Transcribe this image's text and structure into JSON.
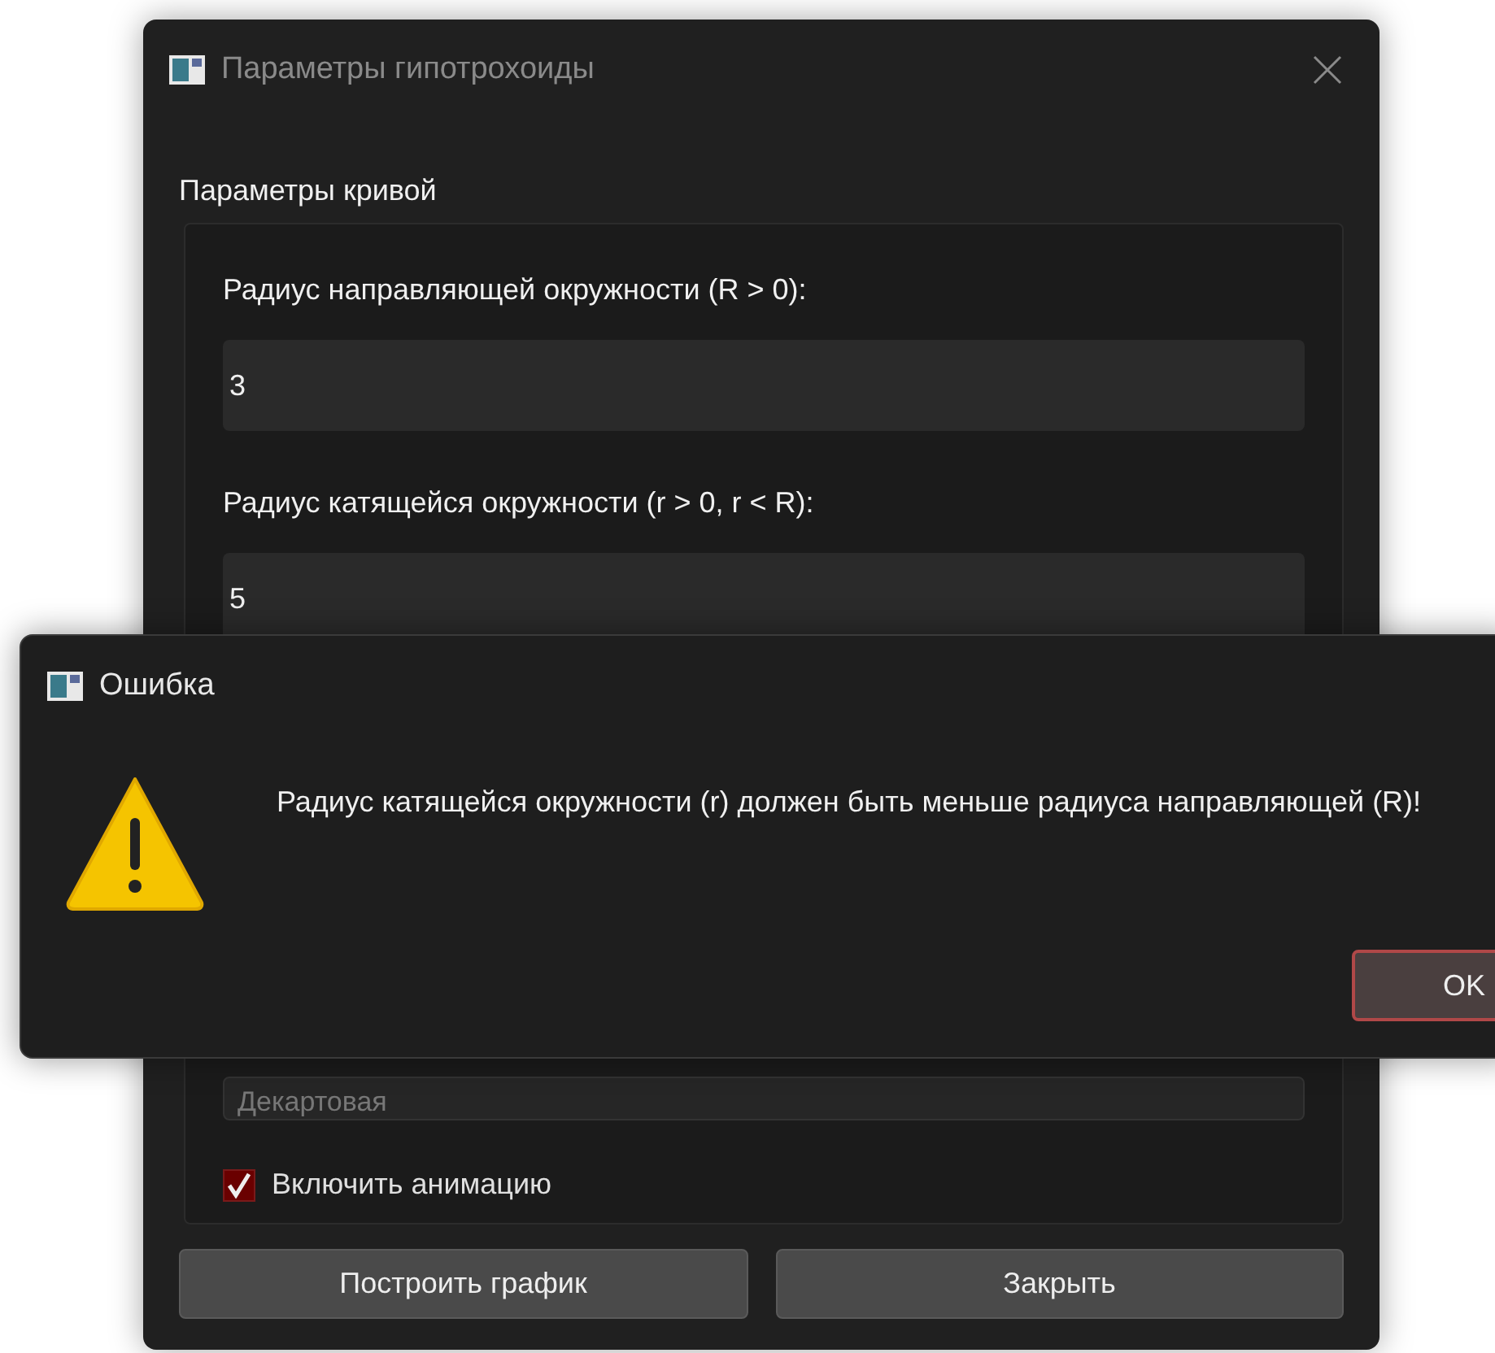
{
  "main_window": {
    "title": "Параметры гипотрохоиды",
    "group": {
      "title": "Параметры кривой",
      "fields": [
        {
          "label": "Радиус направляющей окружности (R > 0):",
          "value": "3"
        },
        {
          "label": "Радиус катящейся окружности (r > 0, r < R):",
          "value": "5"
        }
      ],
      "combo": {
        "value": "Декартовая"
      },
      "checkbox": {
        "label": "Включить анимацию",
        "checked": true
      }
    },
    "buttons": [
      "Построить график",
      "Закрыть"
    ]
  },
  "error_dialog": {
    "title": "Ошибка",
    "message": "Радиус катящейся окружности (r) должен быть меньше радиуса направляющей (R)!",
    "button": "OK"
  }
}
